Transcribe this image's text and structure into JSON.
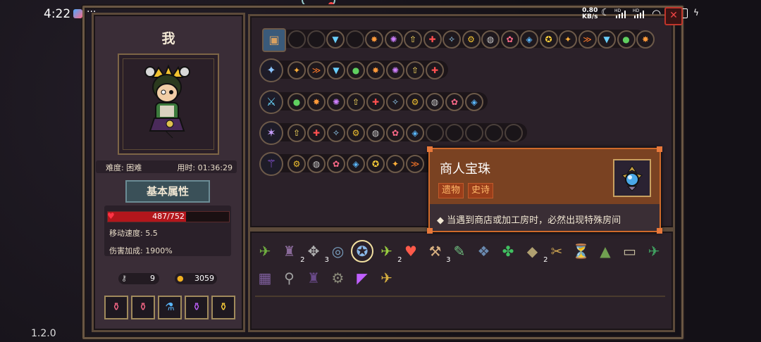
{
  "status_bar": {
    "time": "4:22",
    "more": "···",
    "net_speed": "0.80",
    "net_unit": "KB/s",
    "battery": "66",
    "sig1": "HD",
    "sig2": "HD"
  },
  "close_glyph": "✕",
  "player": {
    "name": "我",
    "difficulty": "难度: 困难",
    "time_used": "用时: 01:36:29",
    "attr_tab": "基本属性",
    "hp_text": "487/752",
    "hp_fraction": 0.648,
    "move_speed": "移动速度: 5.5",
    "damage_bonus": "伤害加成: 1900%",
    "keys": "9",
    "coins": "3059"
  },
  "potions": [
    "pink-potion",
    "pink-potion",
    "blue-potion",
    "purple-potion",
    "yellow-potion"
  ],
  "tooltip": {
    "name": "商人宝珠",
    "tag_type": "遗物",
    "tag_rarity": "史诗",
    "description": "当遇到商店或加工房时，必然出现特殊房间"
  },
  "version": "1.2.0",
  "colors": {
    "accent": "#d06a2a",
    "hp": "#b3161c",
    "frame": "#5c4a3a"
  }
}
